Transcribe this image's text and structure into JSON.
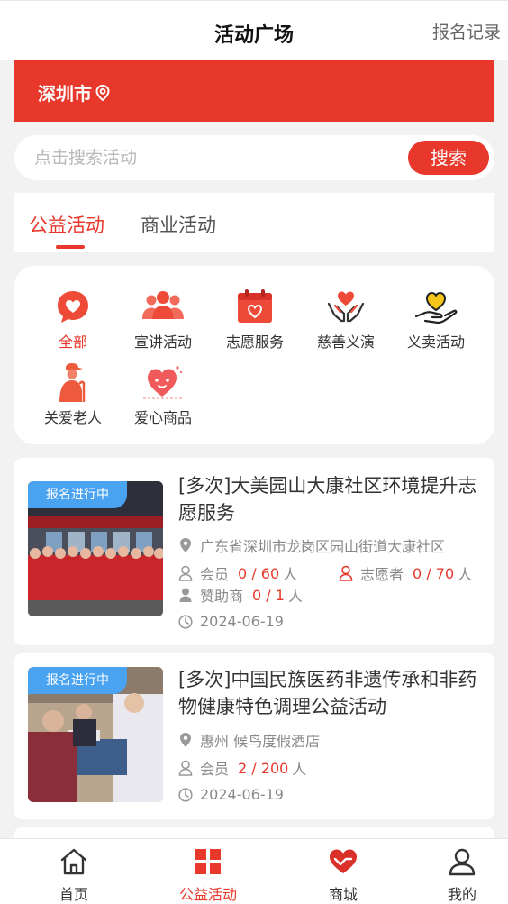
{
  "header": {
    "title": "活动广场",
    "record_link": "报名记录"
  },
  "city": {
    "name": "深圳市",
    "icon": "location-pin-icon"
  },
  "search": {
    "placeholder": "点击搜索活动",
    "button_label": "搜索"
  },
  "tabs": [
    {
      "label": "公益活动",
      "active": true
    },
    {
      "label": "商业活动",
      "active": false
    }
  ],
  "categories": [
    {
      "label": "全部",
      "icon": "heart-bubble-icon",
      "active": true
    },
    {
      "label": "宣讲活动",
      "icon": "people-group-icon"
    },
    {
      "label": "志愿服务",
      "icon": "calendar-heart-icon"
    },
    {
      "label": "慈善义演",
      "icon": "hands-heart-icon"
    },
    {
      "label": "义卖活动",
      "icon": "hand-heart-icon"
    },
    {
      "label": "关爱老人",
      "icon": "elderly-person-icon"
    },
    {
      "label": "爱心商品",
      "icon": "heart-face-icon"
    }
  ],
  "activities": [
    {
      "badge": "报名进行中",
      "title": "[多次]大美园山大康社区环境提升志愿服务",
      "location": "广东省深圳市龙岗区园山街道大康社区",
      "member_label": "会员",
      "member_count": "0 / 60",
      "member_unit": "人",
      "volunteer_label": "志愿者",
      "volunteer_count": "0 / 70",
      "volunteer_unit": "人",
      "sponsor_label": "赞助商",
      "sponsor_count": "0 / 1",
      "sponsor_unit": "人",
      "date": "2024-06-19"
    },
    {
      "badge": "报名进行中",
      "title": "[多次]中国民族医药非遗传承和非药物健康特色调理公益活动",
      "location": "惠州 候鸟度假酒店",
      "member_label": "会员",
      "member_count": "2 / 200",
      "member_unit": "人",
      "date": "2024-06-19"
    }
  ],
  "tabbar": [
    {
      "label": "首页",
      "icon": "home-icon"
    },
    {
      "label": "公益活动",
      "icon": "grid-icon",
      "active": true
    },
    {
      "label": "商城",
      "icon": "heart-hands-icon"
    },
    {
      "label": "我的",
      "icon": "user-icon"
    }
  ],
  "colors": {
    "primary": "#e8382b",
    "badge": "#4aa3f0",
    "background": "#f2f2f2"
  }
}
